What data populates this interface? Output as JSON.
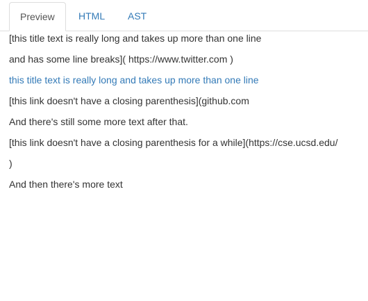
{
  "tabs": [
    {
      "label": "Preview",
      "active": true
    },
    {
      "label": "HTML",
      "active": false
    },
    {
      "label": "AST",
      "active": false
    }
  ],
  "preview": {
    "lines": [
      {
        "text": "[this title text is really long and takes up more than one line",
        "is_link": false
      },
      {
        "text": "and has some line breaks]( https://www.twitter.com )",
        "is_link": false
      },
      {
        "text": "this title text is really long and takes up more than one line",
        "is_link": true
      },
      {
        "text": "[this link doesn't have a closing parenthesis](github.com",
        "is_link": false
      },
      {
        "text": "And there's still some more text after that.",
        "is_link": false
      },
      {
        "text": "[this link doesn't have a closing parenthesis for a while](https://cse.ucsd.edu/",
        "is_link": false
      },
      {
        "text": ")",
        "is_link": false
      },
      {
        "text": "And then there's more text",
        "is_link": false
      }
    ]
  },
  "colors": {
    "link": "#337ab7",
    "text": "#333333",
    "border": "#dddddd"
  }
}
